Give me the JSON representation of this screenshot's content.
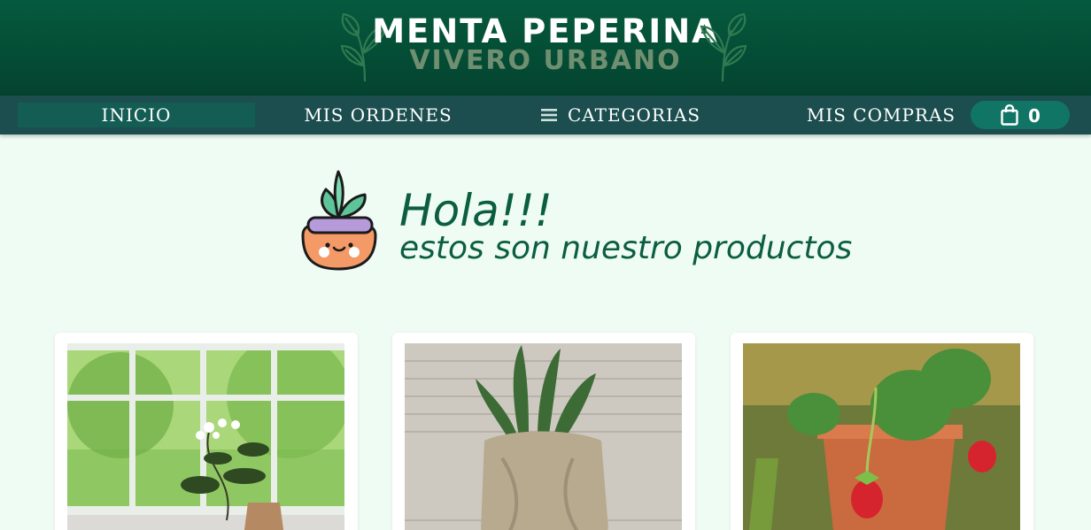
{
  "header": {
    "title": "MENTA PEPERINA",
    "subtitle": "VIVERO URBANO",
    "decor_icon": "mint-leaves-icon"
  },
  "nav": {
    "items": [
      {
        "label": "INICIO",
        "active": true
      },
      {
        "label": "MIS ORDENES"
      },
      {
        "label": "CATEGORIAS",
        "icon": "hamburger-menu-icon"
      },
      {
        "label": "MIS COMPRAS"
      }
    ],
    "cart": {
      "icon": "shopping-bag-icon",
      "count": "0"
    }
  },
  "greeting": {
    "title": "Hola!!!",
    "subtitle": "estos son nuestro productos",
    "mascot_icon": "potted-plant-mascot-icon"
  },
  "products": [
    {
      "image": "hoya-plant-on-windowsill-photo"
    },
    {
      "image": "snake-plant-in-burlap-pot-photo"
    },
    {
      "image": "strawberry-plant-in-pot-photo"
    }
  ],
  "colors": {
    "header_bg": "#055a3e",
    "nav_bg": "#1c4e4f",
    "nav_active": "#145d55",
    "cart_bg": "#117565",
    "page_bg": "#effcf4",
    "greeting_text": "#0b5e3f"
  }
}
